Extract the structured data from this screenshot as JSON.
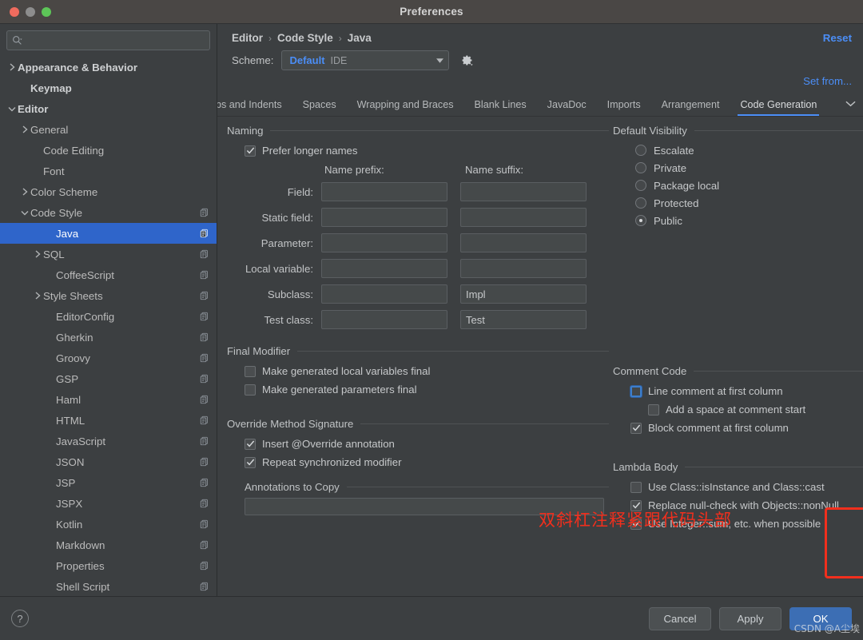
{
  "window": {
    "title": "Preferences"
  },
  "search": {
    "placeholder": "",
    "value": "",
    "icon": "search-icon"
  },
  "sidebar": {
    "items": [
      {
        "label": "Appearance & Behavior",
        "indent": 0,
        "twisty": "right",
        "bold": true,
        "copy": false,
        "selected": false
      },
      {
        "label": "Keymap",
        "indent": 1,
        "twisty": "none",
        "bold": true,
        "copy": false,
        "selected": false
      },
      {
        "label": "Editor",
        "indent": 0,
        "twisty": "down",
        "bold": true,
        "copy": false,
        "selected": false
      },
      {
        "label": "General",
        "indent": 1,
        "twisty": "right",
        "bold": false,
        "copy": false,
        "selected": false
      },
      {
        "label": "Code Editing",
        "indent": 2,
        "twisty": "none",
        "bold": false,
        "copy": false,
        "selected": false
      },
      {
        "label": "Font",
        "indent": 2,
        "twisty": "none",
        "bold": false,
        "copy": false,
        "selected": false
      },
      {
        "label": "Color Scheme",
        "indent": 1,
        "twisty": "right",
        "bold": false,
        "copy": false,
        "selected": false
      },
      {
        "label": "Code Style",
        "indent": 1,
        "twisty": "down",
        "bold": false,
        "copy": true,
        "selected": false
      },
      {
        "label": "Java",
        "indent": 3,
        "twisty": "none",
        "bold": false,
        "copy": true,
        "selected": true
      },
      {
        "label": "SQL",
        "indent": 2,
        "twisty": "right",
        "bold": false,
        "copy": true,
        "selected": false
      },
      {
        "label": "CoffeeScript",
        "indent": 3,
        "twisty": "none",
        "bold": false,
        "copy": true,
        "selected": false
      },
      {
        "label": "Style Sheets",
        "indent": 2,
        "twisty": "right",
        "bold": false,
        "copy": true,
        "selected": false
      },
      {
        "label": "EditorConfig",
        "indent": 3,
        "twisty": "none",
        "bold": false,
        "copy": true,
        "selected": false
      },
      {
        "label": "Gherkin",
        "indent": 3,
        "twisty": "none",
        "bold": false,
        "copy": true,
        "selected": false
      },
      {
        "label": "Groovy",
        "indent": 3,
        "twisty": "none",
        "bold": false,
        "copy": true,
        "selected": false
      },
      {
        "label": "GSP",
        "indent": 3,
        "twisty": "none",
        "bold": false,
        "copy": true,
        "selected": false
      },
      {
        "label": "Haml",
        "indent": 3,
        "twisty": "none",
        "bold": false,
        "copy": true,
        "selected": false
      },
      {
        "label": "HTML",
        "indent": 3,
        "twisty": "none",
        "bold": false,
        "copy": true,
        "selected": false
      },
      {
        "label": "JavaScript",
        "indent": 3,
        "twisty": "none",
        "bold": false,
        "copy": true,
        "selected": false
      },
      {
        "label": "JSON",
        "indent": 3,
        "twisty": "none",
        "bold": false,
        "copy": true,
        "selected": false
      },
      {
        "label": "JSP",
        "indent": 3,
        "twisty": "none",
        "bold": false,
        "copy": true,
        "selected": false
      },
      {
        "label": "JSPX",
        "indent": 3,
        "twisty": "none",
        "bold": false,
        "copy": true,
        "selected": false
      },
      {
        "label": "Kotlin",
        "indent": 3,
        "twisty": "none",
        "bold": false,
        "copy": true,
        "selected": false
      },
      {
        "label": "Markdown",
        "indent": 3,
        "twisty": "none",
        "bold": false,
        "copy": true,
        "selected": false
      },
      {
        "label": "Properties",
        "indent": 3,
        "twisty": "none",
        "bold": false,
        "copy": true,
        "selected": false
      },
      {
        "label": "Shell Script",
        "indent": 3,
        "twisty": "none",
        "bold": false,
        "copy": true,
        "selected": false
      }
    ]
  },
  "header": {
    "breadcrumb": [
      "Editor",
      "Code Style",
      "Java"
    ],
    "separator": "›",
    "reset_label": "Reset",
    "scheme_label": "Scheme:",
    "scheme_value": "Default",
    "scheme_suffix": "IDE",
    "gear_icon": "gear-icon",
    "set_from_label": "Set from..."
  },
  "tabs": {
    "items": [
      {
        "label": "bs and Indents",
        "active": false
      },
      {
        "label": "Spaces",
        "active": false
      },
      {
        "label": "Wrapping and Braces",
        "active": false
      },
      {
        "label": "Blank Lines",
        "active": false
      },
      {
        "label": "JavaDoc",
        "active": false
      },
      {
        "label": "Imports",
        "active": false
      },
      {
        "label": "Arrangement",
        "active": false
      },
      {
        "label": "Code Generation",
        "active": true
      }
    ],
    "overflow_icon": "chevron-down-icon"
  },
  "naming": {
    "title": "Naming",
    "prefer_longer": {
      "label": "Prefer longer names",
      "checked": true
    },
    "col_prefix": "Name prefix:",
    "col_suffix": "Name suffix:",
    "rows": [
      {
        "label": "Field:",
        "prefix": "",
        "suffix": ""
      },
      {
        "label": "Static field:",
        "prefix": "",
        "suffix": ""
      },
      {
        "label": "Parameter:",
        "prefix": "",
        "suffix": ""
      },
      {
        "label": "Local variable:",
        "prefix": "",
        "suffix": ""
      },
      {
        "label": "Subclass:",
        "prefix": "",
        "suffix": "Impl"
      },
      {
        "label": "Test class:",
        "prefix": "",
        "suffix": "Test"
      }
    ]
  },
  "visibility": {
    "title": "Default Visibility",
    "options": [
      {
        "label": "Escalate",
        "selected": false
      },
      {
        "label": "Private",
        "selected": false
      },
      {
        "label": "Package local",
        "selected": false
      },
      {
        "label": "Protected",
        "selected": false
      },
      {
        "label": "Public",
        "selected": true
      }
    ]
  },
  "final_modifier": {
    "title": "Final Modifier",
    "options": [
      {
        "label": "Make generated local variables final",
        "checked": false
      },
      {
        "label": "Make generated parameters final",
        "checked": false
      }
    ]
  },
  "comment_code": {
    "title": "Comment Code",
    "options": [
      {
        "label": "Line comment at first column",
        "checked": false,
        "focused": true,
        "indent": 1
      },
      {
        "label": "Add a space at comment start",
        "checked": false,
        "focused": false,
        "indent": 2
      },
      {
        "label": "Block comment at first column",
        "checked": true,
        "focused": false,
        "indent": 1
      }
    ]
  },
  "override": {
    "title": "Override Method Signature",
    "options": [
      {
        "label": "Insert @Override annotation",
        "checked": true
      },
      {
        "label": "Repeat synchronized modifier",
        "checked": true
      }
    ],
    "annotations_title": "Annotations to Copy",
    "annotations_value": ""
  },
  "lambda": {
    "title": "Lambda Body",
    "options": [
      {
        "label": "Use Class::isInstance and Class::cast",
        "checked": false
      },
      {
        "label": "Replace null-check with Objects::nonNull",
        "checked": true
      },
      {
        "label": "Use Integer::sum, etc. when possible",
        "checked": true
      }
    ]
  },
  "annotation": {
    "note_text": "双斜杠注释紧跟代码头部",
    "note_color": "#f22f1d"
  },
  "footer": {
    "help_label": "?",
    "cancel_label": "Cancel",
    "apply_label": "Apply",
    "ok_label": "OK",
    "watermark": "CSDN @A尘埃"
  }
}
